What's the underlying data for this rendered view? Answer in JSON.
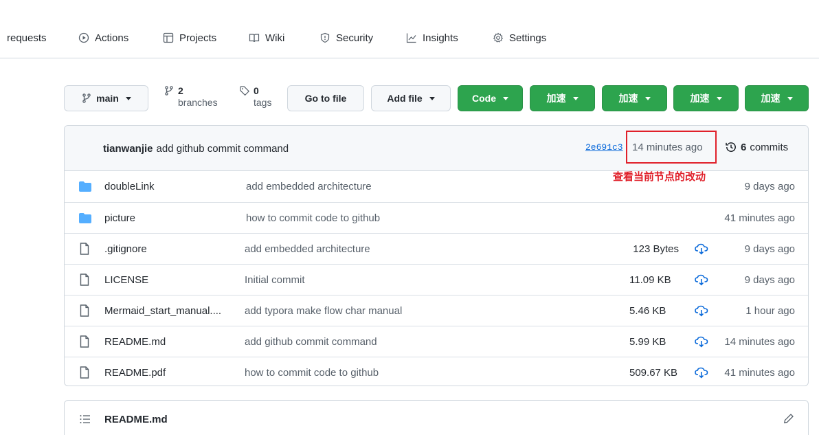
{
  "nav": {
    "pull_requests": "requests",
    "actions": "Actions",
    "projects": "Projects",
    "wiki": "Wiki",
    "security": "Security",
    "insights": "Insights",
    "settings": "Settings"
  },
  "toolbar": {
    "branch": "main",
    "branches_count": "2",
    "branches_label": "branches",
    "tags_count": "0",
    "tags_label": "tags",
    "go_to_file": "Go to file",
    "add_file": "Add file",
    "code": "Code",
    "speed_buttons": [
      "加速",
      "加速",
      "加速",
      "加速"
    ]
  },
  "commit": {
    "author": "tianwanjie",
    "message": "add github commit command",
    "sha": "2e691c3",
    "time": "14 minutes ago",
    "commits_count": "6",
    "commits_label": "commits"
  },
  "annotation": {
    "text": "查看当前节点的改动",
    "color": "#e0202a"
  },
  "files": [
    {
      "type": "folder",
      "name": "doubleLink",
      "message": "add embedded architecture",
      "size": "",
      "time": "9 days ago"
    },
    {
      "type": "folder",
      "name": "picture",
      "message": "how to commit code to github",
      "size": "",
      "time": "41 minutes ago"
    },
    {
      "type": "file",
      "name": ".gitignore",
      "message": "add embedded architecture",
      "size": "123 Bytes",
      "time": "9 days ago"
    },
    {
      "type": "file",
      "name": "LICENSE",
      "message": "Initial commit",
      "size": "11.09 KB",
      "time": "9 days ago"
    },
    {
      "type": "file",
      "name": "Mermaid_start_manual....",
      "message": "add typora make flow char manual",
      "size": "5.46 KB",
      "time": "1 hour ago"
    },
    {
      "type": "file",
      "name": "README.md",
      "message": "add github commit command",
      "size": "5.99 KB",
      "time": "14 minutes ago"
    },
    {
      "type": "file",
      "name": "README.pdf",
      "message": "how to commit code to github",
      "size": "509.67 KB",
      "time": "41 minutes ago"
    }
  ],
  "readme": {
    "title": "README.md"
  },
  "colors": {
    "green": "#2da44e",
    "folder": "#54aeff",
    "link": "#0969da",
    "border": "#d0d7de"
  }
}
